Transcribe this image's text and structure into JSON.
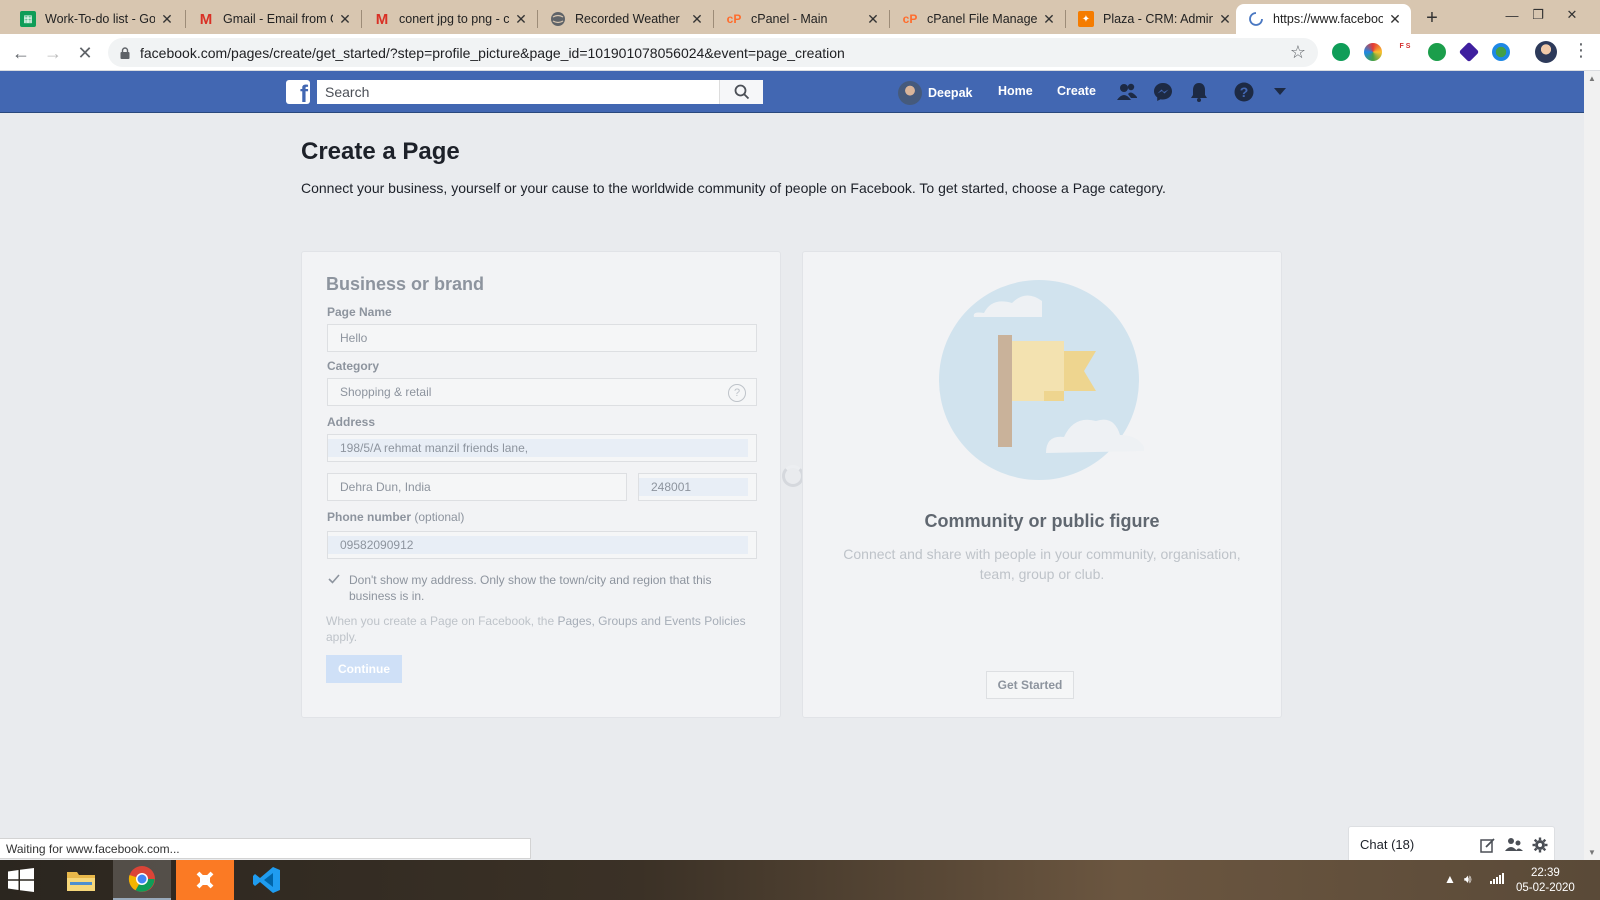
{
  "browser": {
    "tabs": [
      {
        "title": "Work-To-do list - Go",
        "icon": "sheets-icon",
        "color": "#0f9d58"
      },
      {
        "title": "Gmail - Email from G",
        "icon": "gmail-icon",
        "color": "#d93025"
      },
      {
        "title": "conert jpg to png - c",
        "icon": "gmail-icon",
        "color": "#d93025"
      },
      {
        "title": "Recorded Weather",
        "icon": "globe-icon",
        "color": "#5f6368"
      },
      {
        "title": "cPanel - Main",
        "icon": "cpanel-icon",
        "color": "#ff6c2c"
      },
      {
        "title": "cPanel File Manager",
        "icon": "cpanel-icon",
        "color": "#ff6c2c"
      },
      {
        "title": "Plaza - CRM: Admin l",
        "icon": "plaza-icon",
        "color": "#f57c00"
      },
      {
        "title": "https://www.faceboo",
        "icon": "loading-icon",
        "color": "#5f6368"
      }
    ],
    "url": "facebook.com/pages/create/get_started/?step=profile_picture&page_id=101901078056024&event=page_creation",
    "status_text": "Waiting for www.facebook.com..."
  },
  "fb": {
    "search_placeholder": "Search",
    "user_name": "Deepak",
    "nav_home": "Home",
    "nav_create": "Create",
    "brand_color": "#4267b2"
  },
  "page": {
    "title": "Create a Page",
    "subtitle": "Connect your business, yourself or your cause to the worldwide community of people on Facebook. To get started, choose a Page category."
  },
  "business_card": {
    "heading": "Business or brand",
    "page_name_label": "Page Name",
    "page_name_value": "Hello",
    "category_label": "Category",
    "category_value": "Shopping & retail",
    "address_label": "Address",
    "address_value": "198/5/A rehmat manzil friends lane,",
    "city_value": "Dehra Dun, India",
    "zip_value": "248001",
    "phone_label": "Phone number",
    "phone_optional": "(optional)",
    "phone_value": "09582090912",
    "hide_address_text": "Don't show my address. Only show the town/city and region that this business is in.",
    "policy_prefix": "When you create a Page on Facebook, the ",
    "policy_link": "Pages, Groups and Events Policies",
    "policy_suffix": " apply.",
    "continue_label": "Continue"
  },
  "community_card": {
    "heading": "Community or public figure",
    "description": "Connect and share with people in your community, organisation, team, group or club.",
    "button_label": "Get Started"
  },
  "chat": {
    "label": "Chat (18)"
  },
  "taskbar": {
    "time": "22:39",
    "date": "05-02-2020"
  }
}
